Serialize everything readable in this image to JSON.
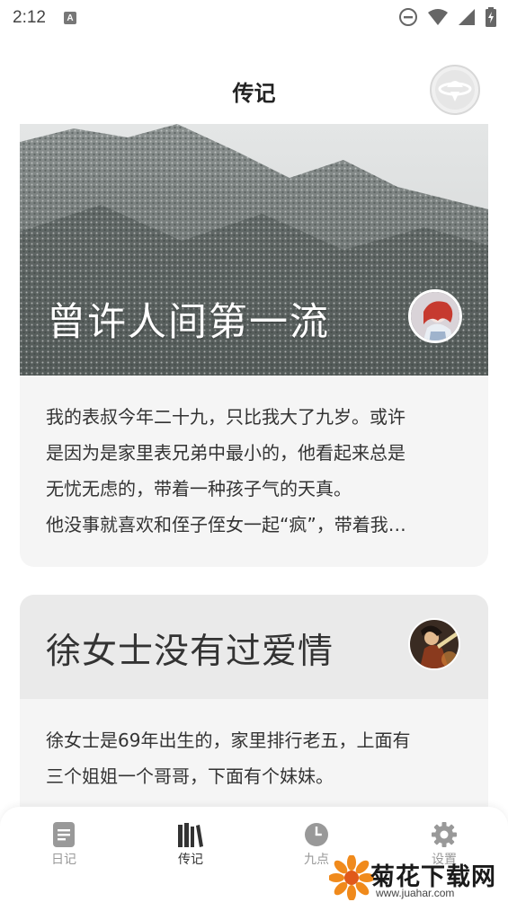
{
  "status_bar": {
    "time": "2:12",
    "notification_icon": "a-letter-icon",
    "icons": [
      "do-not-disturb-icon",
      "wifi-icon",
      "signal-icon",
      "battery-charging-icon"
    ]
  },
  "header": {
    "title": "传记",
    "avatar_icon": "planet-ufo-icon"
  },
  "cards": [
    {
      "title": "曾许人间第一流",
      "excerpt": [
        "我的表叔今年二十九，只比我大了九岁。或许",
        "是因为是家里表兄弟中最小的，他看起来总是",
        "无忧无虑的，带着一种孩子气的天真。",
        "他没事就喜欢和侄子侄女一起“疯”，带着我…"
      ]
    },
    {
      "title": "徐女士没有过爱情",
      "excerpt": [
        "徐女士是69年出生的，家里排行老五，上面有",
        "三个姐姐一个哥哥，下面有个妹妹。"
      ]
    }
  ],
  "bottom_nav": {
    "items": [
      {
        "label": "日记",
        "icon": "document-icon",
        "active": false
      },
      {
        "label": "传记",
        "icon": "books-icon",
        "active": true
      },
      {
        "label": "九点",
        "icon": "clock-icon",
        "active": false
      },
      {
        "label": "设置",
        "icon": "gear-icon",
        "active": false
      }
    ]
  },
  "watermark": {
    "text": "菊花下载网",
    "url": "www.juahar.com"
  },
  "colors": {
    "background": "#ffffff",
    "card_bg": "#f5f5f5",
    "nav_active": "#333333",
    "nav_inactive": "#999999"
  }
}
